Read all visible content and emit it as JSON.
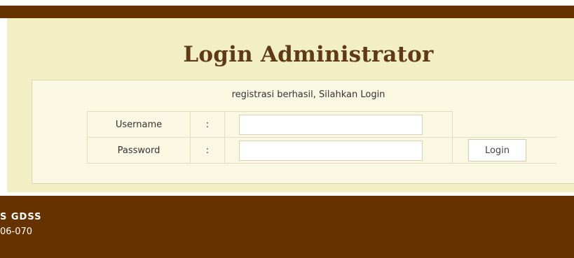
{
  "header": {
    "title": "Login Administrator"
  },
  "login": {
    "message": "registrasi berhasil, Silahkan Login",
    "username_label": "Username",
    "password_label": "Password",
    "separator": ":",
    "username_value": "",
    "password_value": "",
    "button_label": "Login"
  },
  "footer": {
    "line1": "S GDSS",
    "line2": "06-070"
  },
  "colors": {
    "brown_bar": "#663300",
    "panel": "#f3efc4",
    "box": "#faf7e2",
    "title": "#5e3a16"
  }
}
